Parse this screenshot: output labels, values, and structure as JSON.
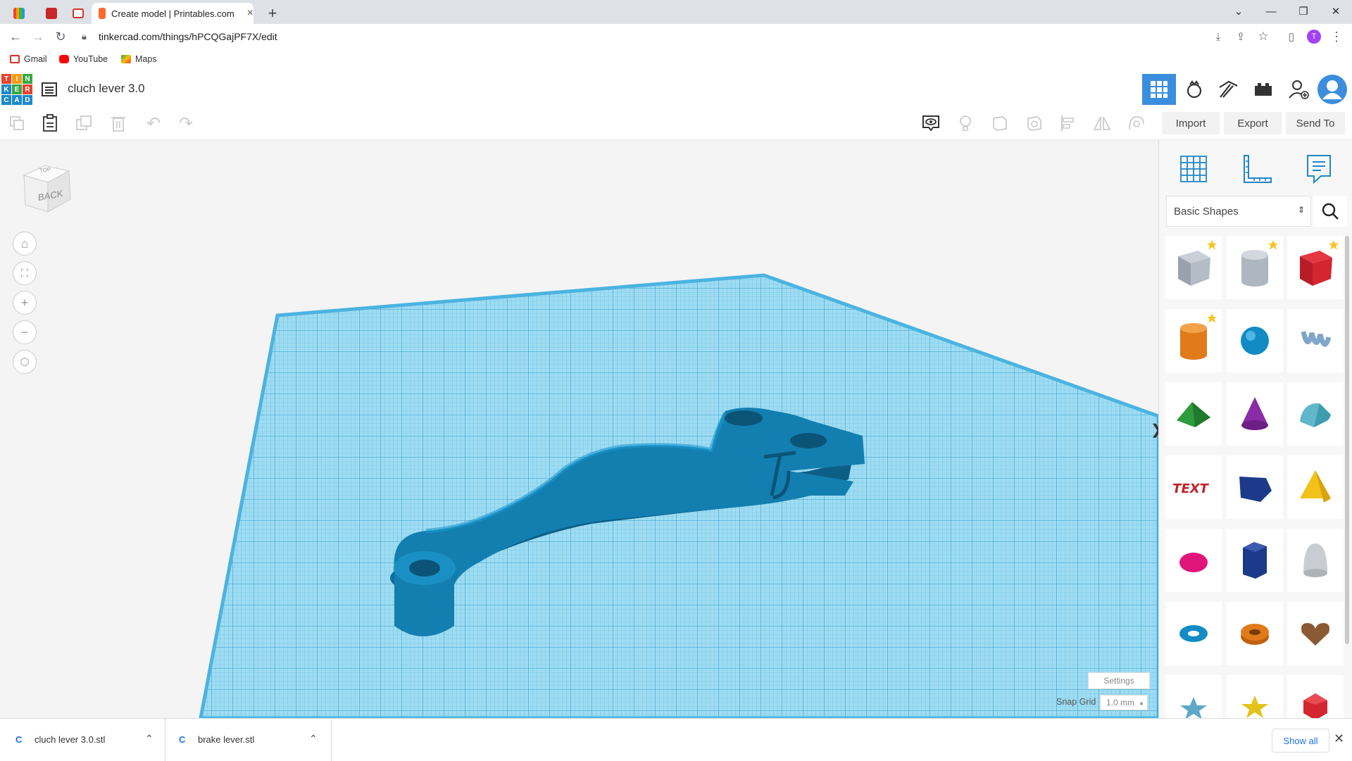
{
  "browser": {
    "tabs": [
      {
        "title": ""
      },
      {
        "title": ""
      },
      {
        "title": ""
      },
      {
        "title": "Create model | Printables.com",
        "close": "×"
      }
    ],
    "new_tab": "+",
    "url": "tinkercad.com/things/hPCQGajPF7X/edit",
    "profile_initial": "T",
    "bookmarks": [
      {
        "label": "Gmail"
      },
      {
        "label": "YouTube"
      },
      {
        "label": "Maps"
      }
    ]
  },
  "app": {
    "logo_letters": [
      "T",
      "I",
      "N",
      "K",
      "E",
      "R",
      "C",
      "A",
      "D"
    ],
    "design_title": "cluch lever 3.0",
    "toolbar": {
      "import": "Import",
      "export": "Export",
      "send_to": "Send To"
    },
    "view_cube_face": "BACK",
    "view_cube_top": "TOP",
    "panel": {
      "category": "Basic Shapes"
    },
    "settings": "Settings",
    "snap_grid_label": "Snap Grid",
    "snap_grid_value": "1.0 mm"
  },
  "downloads": {
    "items": [
      {
        "name": "cluch lever 3.0.stl"
      },
      {
        "name": "brake lever.stl"
      }
    ],
    "show_all": "Show all"
  },
  "colors": {
    "tinkercad_blue": "#1e88c8",
    "grid_blue": "#7ccfee",
    "model_blue": "#137fb0",
    "accent_header": "#3b8ede"
  }
}
